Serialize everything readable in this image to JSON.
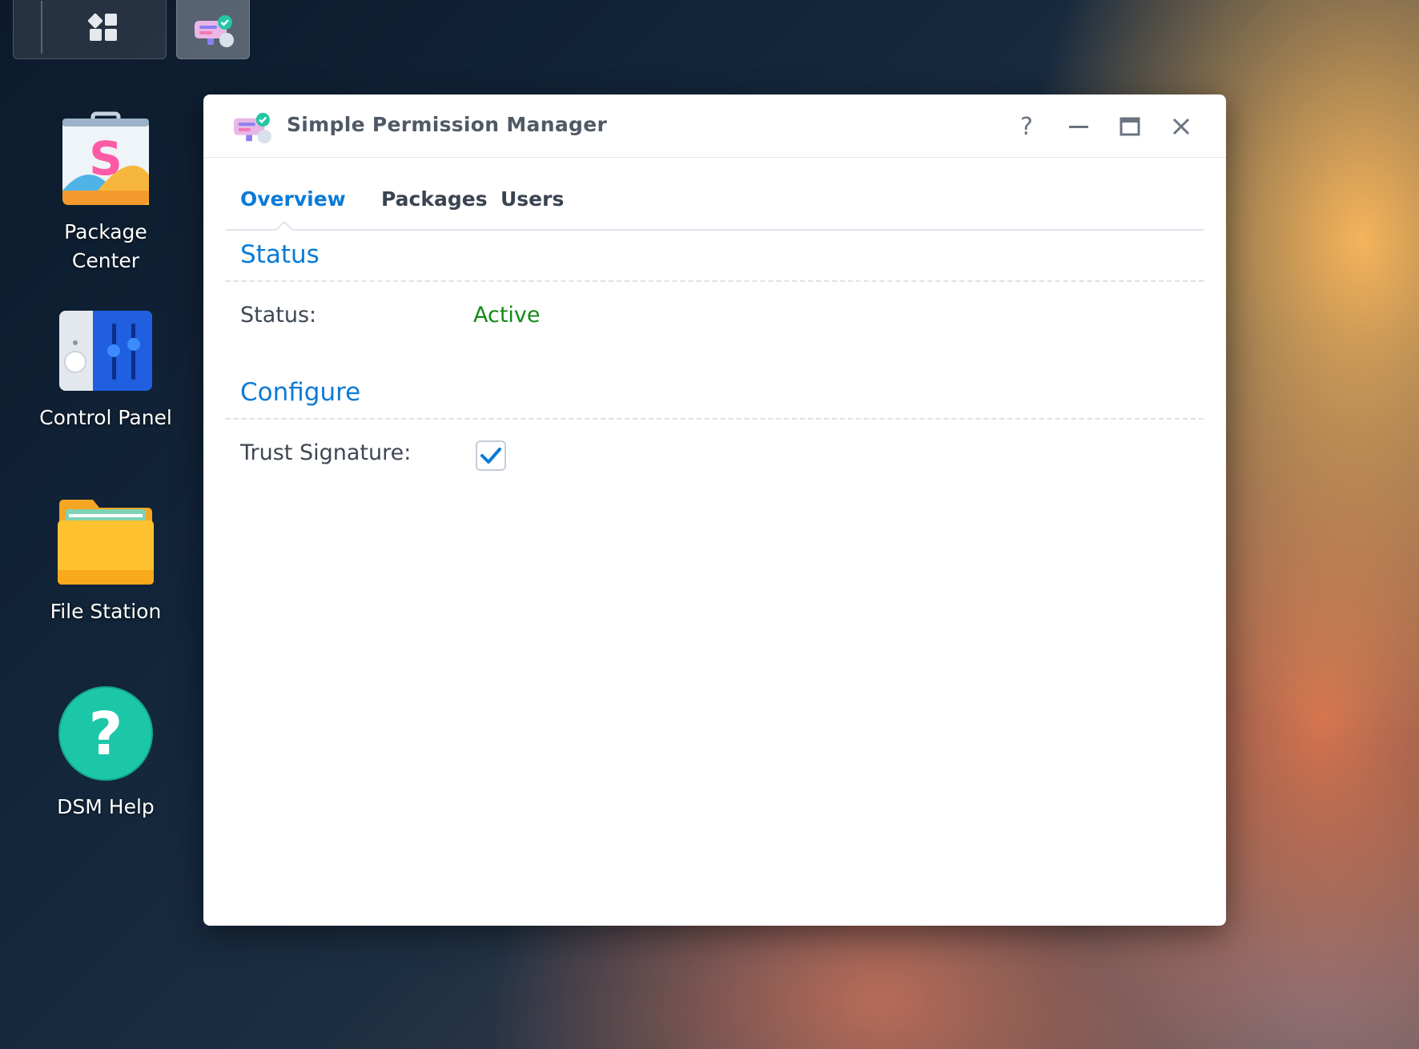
{
  "desktop": {
    "icons": [
      {
        "label": "Package\nCenter",
        "icon": "package-center-icon"
      },
      {
        "label": "Control Panel",
        "icon": "control-panel-icon"
      },
      {
        "label": "File Station",
        "icon": "file-station-icon"
      },
      {
        "label": "DSM Help",
        "icon": "dsm-help-icon"
      }
    ]
  },
  "taskbar": {
    "main_menu_icon": "main-menu-grid-icon",
    "open_app_icon": "simple-permission-manager-icon"
  },
  "window": {
    "title": "Simple Permission Manager",
    "controls": {
      "help": "?",
      "minimize_icon": "minimize-icon",
      "maximize_icon": "maximize-icon",
      "close_icon": "close-icon"
    },
    "tabs": [
      {
        "label": "Overview",
        "active": true
      },
      {
        "label": "Packages",
        "active": false
      },
      {
        "label": "Users",
        "active": false
      }
    ],
    "status_section": {
      "title": "Status",
      "label": "Status:",
      "value": "Active"
    },
    "configure_section": {
      "title": "Configure",
      "label": "Trust Signature:",
      "checked": true
    }
  },
  "colors": {
    "accent": "#0a7bd6",
    "active_status": "#128a12"
  }
}
